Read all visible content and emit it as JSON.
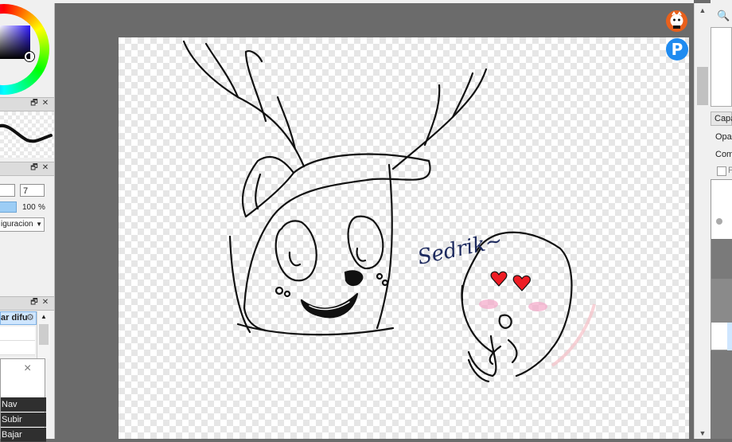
{
  "left_panel": {
    "brush_size_value": "7",
    "opacity_value": "100",
    "opacity_unit": "%",
    "config_dropdown": "iguracion",
    "layer_mode_header": "ar difu",
    "popup_items": [
      "Nav",
      "Subir",
      "Bajar"
    ],
    "popup_close": "×"
  },
  "right_panel": {
    "layer_tab": "Capa",
    "opacity_label": "Opac",
    "blend_label": "Comb",
    "protect_label": "P"
  },
  "canvas": {
    "signature_text": "Sedrik~"
  },
  "icons": {
    "zoom": "zoom-icon",
    "restore": "restore-window-icon",
    "close": "close-icon",
    "picsart": "picsart-icon"
  },
  "picsart_letter": "P",
  "colors": {
    "canvas_bg": "#ffffff",
    "workspace_bg": "#6b6b6b",
    "accent": "#1f8bf0",
    "selected_layer": "#cfe6ff",
    "heart": "#ee1c24",
    "blush": "#f4a7c8"
  }
}
